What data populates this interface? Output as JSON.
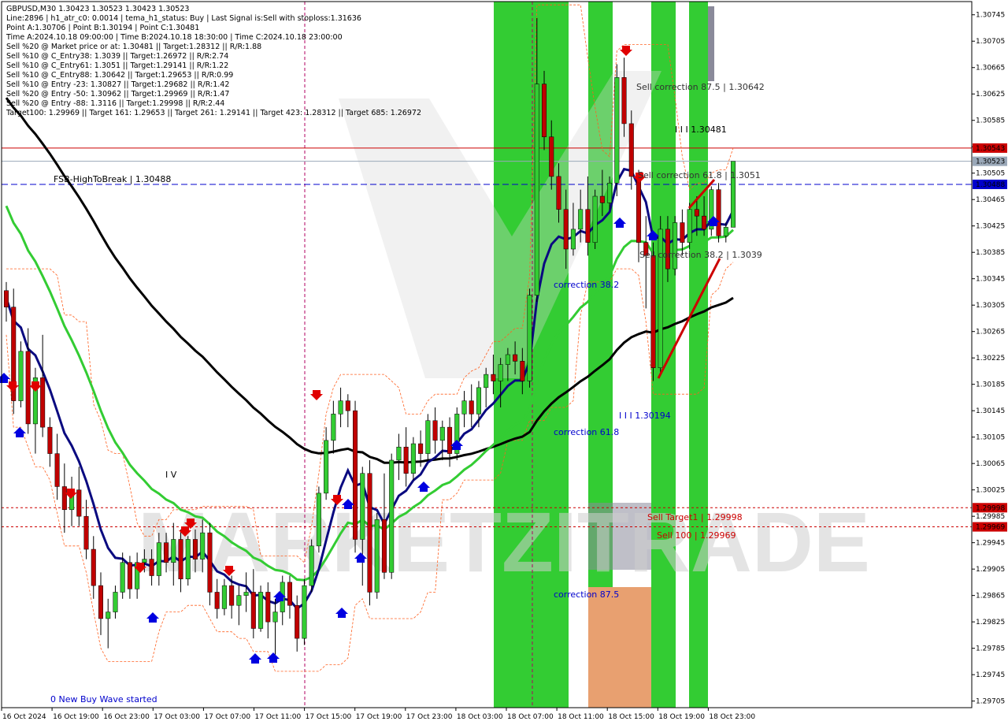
{
  "header": {
    "lines": [
      "GBPUSD,M30  1.30423 1.30523 1.30423 1.30523",
      "Line:2896  |  h1_atr_c0: 0.0014  |  tema_h1_status: Buy  |  Last Signal is:Sell with stoploss:1.31636",
      "Point A:1.30706  |  Point B:1.30194  |  Point C:1.30481",
      "Time A:2024.10.18 09:00:00  |  Time B:2024.10.18 18:30:00  |  Time C:2024.10.18 23:00:00",
      "Sell %20 @ Market price or at: 1.30481  ||  Target:1.28312  ||  R/R:1.88",
      "Sell %10 @ C_Entry38: 1.3039  ||  Target:1.26972  ||  R/R:2.74",
      "Sell %10 @ C_Entry61: 1.3051  ||  Target:1.29141  ||  R/R:1.22",
      "Sell %10 @ C_Entry88: 1.30642  ||  Target:1.29653  ||  R/R:0.99",
      "Sell %10 @ Entry -23: 1.30827  ||  Target:1.29682  ||  R/R:1.42",
      "Sell %20 @ Entry -50: 1.30962  ||  Target:1.29969  ||  R/R:1.47",
      "Sell %20 @ Entry -88: 1.3116  ||  Target:1.29998  ||  R/R:2.44",
      "Target100: 1.29969  ||  Target 161: 1.29653  ||  Target 261: 1.29141  ||  Target 423: 1.28312  ||  Target 685: 1.26972"
    ]
  },
  "watermark": "MARKETZITRADE",
  "colors": {
    "green_zone": "#33cc33",
    "orange_zone": "#e8a070",
    "grey_zone": "#8a8a9a",
    "ma_black": "#000000",
    "ma_navy": "#0a0a80",
    "ma_green": "#33cc33",
    "envelope": "#ff6020",
    "bull_candle": "#33cc33",
    "bear_candle": "#c00000",
    "red_line": "#cc0000",
    "blue_line": "#0000cc",
    "label_red": "#cc0000",
    "label_blue": "#0000cc"
  },
  "price_axis": {
    "ticks": [
      "1.30745",
      "1.30705",
      "1.30665",
      "1.30625",
      "1.30585",
      "1.30545",
      "1.30505",
      "1.30465",
      "1.30425",
      "1.30385",
      "1.30345",
      "1.30305",
      "1.30265",
      "1.30225",
      "1.30185",
      "1.30145",
      "1.30105",
      "1.30065",
      "1.30025",
      "1.29985",
      "1.29945",
      "1.29905",
      "1.29865",
      "1.29825",
      "1.29785",
      "1.29745",
      "1.29705"
    ],
    "tags": [
      {
        "text": "1.30543",
        "bg": "#cc0000",
        "fg": "#ffffff",
        "price": 1.30543
      },
      {
        "text": "1.30523",
        "bg": "#9aa8b8",
        "fg": "#000000",
        "price": 1.30523
      },
      {
        "text": "1.30488",
        "bg": "#0000cc",
        "fg": "#ffffff",
        "price": 1.30488
      },
      {
        "text": "1.29998",
        "bg": "#cc0000",
        "fg": "#ffffff",
        "price": 1.29998
      },
      {
        "text": "1.29969",
        "bg": "#cc0000",
        "fg": "#ffffff",
        "price": 1.29969
      }
    ]
  },
  "time_axis": {
    "labels": [
      "16 Oct 2024",
      "16 Oct 19:00",
      "16 Oct 23:00",
      "17 Oct 03:00",
      "17 Oct 07:00",
      "17 Oct 11:00",
      "17 Oct 15:00",
      "17 Oct 19:00",
      "17 Oct 23:00",
      "18 Oct 03:00",
      "18 Oct 07:00",
      "18 Oct 11:00",
      "18 Oct 15:00",
      "18 Oct 19:00",
      "18 Oct 23:00"
    ]
  },
  "annotations": {
    "fsb": "FSB-HighToBreak  |  1.30488",
    "sell_corr_875": "Sell correction 87.5 | 1.30642",
    "sell_corr_618": "Sell correction 61.8 | 1.3051",
    "sell_corr_382": "Sell correction 38.2 | 1.3039",
    "point_c": "I I I  1.30481",
    "point_b": "I I I  1.30194",
    "corr_382": "correction 38.2",
    "corr_618": "correction 61.8",
    "corr_875": "correction 87.5",
    "sell_target1": "Sell Target1 | 1.29998",
    "sell_100": "Sell 100 | 1.29969",
    "wave_iv": "I V",
    "new_buy_wave": "0 New Buy Wave started"
  },
  "chart_data": {
    "type": "candlestick",
    "symbol": "GBPUSD",
    "timeframe": "M30",
    "ohlc_last": {
      "open": 1.30423,
      "high": 1.30523,
      "low": 1.30423,
      "close": 1.30523
    },
    "ylim": [
      1.29695,
      1.30765
    ],
    "horizontal_levels": [
      {
        "price": 1.30543,
        "style": "solid",
        "color": "#cc0000"
      },
      {
        "price": 1.30523,
        "style": "solid",
        "color": "#9aa8b8"
      },
      {
        "price": 1.30488,
        "style": "dashed",
        "color": "#0000cc"
      },
      {
        "price": 1.29998,
        "style": "dotted",
        "color": "#cc0000"
      },
      {
        "price": 1.29969,
        "style": "dotted",
        "color": "#cc0000"
      }
    ],
    "candles": [
      [
        1.30327,
        1.3034,
        1.3028,
        1.30302
      ],
      [
        1.30302,
        1.3033,
        1.3014,
        1.3016
      ],
      [
        1.3016,
        1.3025,
        1.3015,
        1.30235
      ],
      [
        1.30235,
        1.3027,
        1.3011,
        1.30125
      ],
      [
        1.30125,
        1.3021,
        1.3008,
        1.30195
      ],
      [
        1.30195,
        1.3026,
        1.30105,
        1.3012
      ],
      [
        1.3012,
        1.30135,
        1.3006,
        1.3008
      ],
      [
        1.3008,
        1.3011,
        1.3001,
        1.3003
      ],
      [
        1.3003,
        1.30065,
        1.2996,
        1.29995
      ],
      [
        1.29995,
        1.30045,
        1.2997,
        1.30025
      ],
      [
        1.30025,
        1.3006,
        1.2997,
        1.29985
      ],
      [
        1.29985,
        1.3001,
        1.2992,
        1.29935
      ],
      [
        1.29935,
        1.29955,
        1.2986,
        1.2988
      ],
      [
        1.2988,
        1.299,
        1.29805,
        1.2983
      ],
      [
        1.2983,
        1.2986,
        1.29785,
        1.2984
      ],
      [
        1.2984,
        1.2988,
        1.2983,
        1.2987
      ],
      [
        1.2987,
        1.2993,
        1.2986,
        1.29915
      ],
      [
        1.29915,
        1.29925,
        1.2986,
        1.29875
      ],
      [
        1.29875,
        1.2993,
        1.2986,
        1.29915
      ],
      [
        1.29915,
        1.29935,
        1.299,
        1.2992
      ],
      [
        1.2992,
        1.29935,
        1.2988,
        1.29895
      ],
      [
        1.29895,
        1.2996,
        1.2988,
        1.29945
      ],
      [
        1.29945,
        1.2996,
        1.299,
        1.29915
      ],
      [
        1.29915,
        1.29975,
        1.2988,
        1.2995
      ],
      [
        1.2995,
        1.29965,
        1.2987,
        1.2989
      ],
      [
        1.2989,
        1.29955,
        1.2988,
        1.2995
      ],
      [
        1.2995,
        1.29965,
        1.299,
        1.2992
      ],
      [
        1.2992,
        1.2998,
        1.299,
        1.2996
      ],
      [
        1.2996,
        1.29975,
        1.2985,
        1.2987
      ],
      [
        1.2987,
        1.2989,
        1.2983,
        1.29845
      ],
      [
        1.29845,
        1.2989,
        1.29835,
        1.2988
      ],
      [
        1.2988,
        1.29895,
        1.2983,
        1.2985
      ],
      [
        1.2985,
        1.2988,
        1.2982,
        1.29865
      ],
      [
        1.29865,
        1.299,
        1.2984,
        1.2987
      ],
      [
        1.2987,
        1.29905,
        1.298,
        1.29815
      ],
      [
        1.29815,
        1.2988,
        1.2981,
        1.2987
      ],
      [
        1.2987,
        1.29885,
        1.298,
        1.29825
      ],
      [
        1.29825,
        1.2986,
        1.2977,
        1.2984
      ],
      [
        1.2984,
        1.29895,
        1.2982,
        1.29885
      ],
      [
        1.29885,
        1.29895,
        1.2983,
        1.2985
      ],
      [
        1.2985,
        1.29865,
        1.2978,
        1.298
      ],
      [
        1.298,
        1.2989,
        1.2979,
        1.2988
      ],
      [
        1.2988,
        1.2995,
        1.2987,
        1.2994
      ],
      [
        1.2994,
        1.3003,
        1.2993,
        1.3002
      ],
      [
        1.3002,
        1.3012,
        1.3001,
        1.301
      ],
      [
        1.301,
        1.3016,
        1.3008,
        1.3014
      ],
      [
        1.3014,
        1.3018,
        1.3012,
        1.3016
      ],
      [
        1.3016,
        1.3017,
        1.3012,
        1.30145
      ],
      [
        1.30145,
        1.3016,
        1.2993,
        1.2995
      ],
      [
        1.2995,
        1.3006,
        1.2988,
        1.3005
      ],
      [
        1.3005,
        1.3007,
        1.2985,
        1.2987
      ],
      [
        1.2987,
        1.2999,
        1.2986,
        1.2998
      ],
      [
        1.2998,
        1.3005,
        1.2989,
        1.299
      ],
      [
        1.299,
        1.3008,
        1.2989,
        1.3007
      ],
      [
        1.3007,
        1.3011,
        1.3004,
        1.3009
      ],
      [
        1.3009,
        1.3012,
        1.3003,
        1.3005
      ],
      [
        1.3005,
        1.30105,
        1.3004,
        1.30095
      ],
      [
        1.30095,
        1.30115,
        1.3006,
        1.3008
      ],
      [
        1.3008,
        1.3014,
        1.3007,
        1.3013
      ],
      [
        1.3013,
        1.3015,
        1.3008,
        1.301
      ],
      [
        1.301,
        1.3013,
        1.3007,
        1.3012
      ],
      [
        1.3012,
        1.30135,
        1.3006,
        1.3008
      ],
      [
        1.3008,
        1.3015,
        1.3007,
        1.3014
      ],
      [
        1.3014,
        1.30175,
        1.3012,
        1.3016
      ],
      [
        1.3016,
        1.30185,
        1.3012,
        1.3014
      ],
      [
        1.3014,
        1.3019,
        1.3012,
        1.3018
      ],
      [
        1.3018,
        1.3021,
        1.3015,
        1.302
      ],
      [
        1.302,
        1.3023,
        1.3017,
        1.3019
      ],
      [
        1.3019,
        1.30225,
        1.3015,
        1.30215
      ],
      [
        1.30215,
        1.3024,
        1.3019,
        1.3023
      ],
      [
        1.3023,
        1.3025,
        1.302,
        1.3022
      ],
      [
        1.3022,
        1.3024,
        1.3017,
        1.3019
      ],
      [
        1.3019,
        1.3033,
        1.3018,
        1.3032
      ],
      [
        1.3032,
        1.3074,
        1.3031,
        1.3064
      ],
      [
        1.3064,
        1.3066,
        1.3054,
        1.3056
      ],
      [
        1.3056,
        1.30585,
        1.3048,
        1.305
      ],
      [
        1.305,
        1.3052,
        1.3043,
        1.3045
      ],
      [
        1.3045,
        1.3048,
        1.3036,
        1.3039
      ],
      [
        1.3039,
        1.3046,
        1.3038,
        1.3042
      ],
      [
        1.3042,
        1.3048,
        1.304,
        1.3045
      ],
      [
        1.3045,
        1.305,
        1.3038,
        1.304
      ],
      [
        1.304,
        1.3048,
        1.3039,
        1.3047
      ],
      [
        1.3047,
        1.3051,
        1.3044,
        1.3046
      ],
      [
        1.3046,
        1.305,
        1.3045,
        1.3049
      ],
      [
        1.3049,
        1.3067,
        1.3047,
        1.3065
      ],
      [
        1.3065,
        1.3068,
        1.3056,
        1.3058
      ],
      [
        1.3058,
        1.306,
        1.3048,
        1.305
      ],
      [
        1.305,
        1.3051,
        1.3037,
        1.304
      ],
      [
        1.304,
        1.3044,
        1.303,
        1.3038
      ],
      [
        1.3038,
        1.304,
        1.3019,
        1.3021
      ],
      [
        1.3021,
        1.3044,
        1.302,
        1.3042
      ],
      [
        1.3042,
        1.3044,
        1.3034,
        1.3036
      ],
      [
        1.3036,
        1.3044,
        1.3035,
        1.3043
      ],
      [
        1.3043,
        1.3045,
        1.3038,
        1.304
      ],
      [
        1.304,
        1.3046,
        1.3039,
        1.3045
      ],
      [
        1.3045,
        1.3047,
        1.3041,
        1.3044
      ],
      [
        1.3044,
        1.3047,
        1.3041,
        1.3042
      ],
      [
        1.3042,
        1.30485,
        1.3041,
        1.3048
      ],
      [
        1.3048,
        1.3049,
        1.304,
        1.3041
      ],
      [
        1.3041,
        1.3043,
        1.304,
        1.30423
      ],
      [
        1.30423,
        1.30523,
        1.30423,
        1.30523
      ]
    ],
    "x_labels": [
      "16 Oct 2024",
      "16 Oct 19:00",
      "16 Oct 23:00",
      "17 Oct 03:00",
      "17 Oct 07:00",
      "17 Oct 11:00",
      "17 Oct 15:00",
      "17 Oct 19:00",
      "17 Oct 23:00",
      "18 Oct 03:00",
      "18 Oct 07:00",
      "18 Oct 11:00",
      "18 Oct 15:00",
      "18 Oct 19:00",
      "18 Oct 23:00"
    ]
  }
}
